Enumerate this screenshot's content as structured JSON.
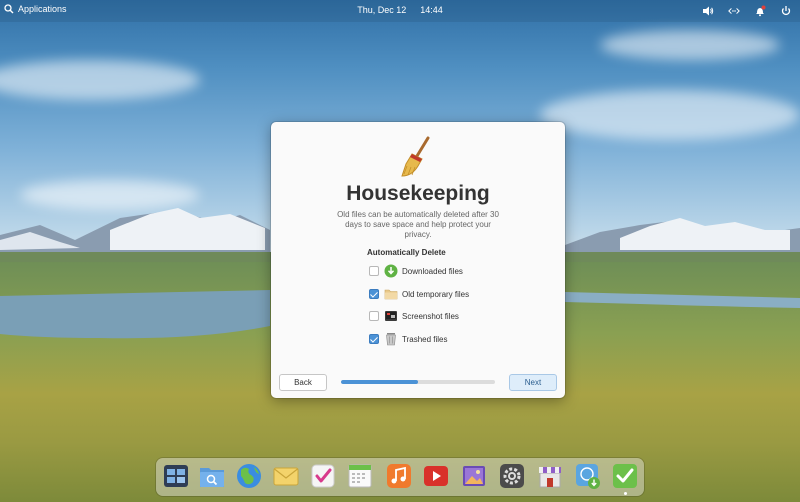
{
  "top_panel": {
    "applications_label": "Applications",
    "date": "Thu, Dec 12",
    "time": "14:44"
  },
  "dialog": {
    "title": "Housekeeping",
    "subtitle": "Old files can be automatically deleted after 30 days to save space and help protect your privacy.",
    "section_label": "Automatically Delete",
    "options": [
      {
        "label": "Downloaded files",
        "checked": false,
        "icon": "download-icon"
      },
      {
        "label": "Old temporary files",
        "checked": true,
        "icon": "folder-icon"
      },
      {
        "label": "Screenshot files",
        "checked": false,
        "icon": "screenshot-icon"
      },
      {
        "label": "Trashed files",
        "checked": true,
        "icon": "trash-icon"
      }
    ],
    "back_label": "Back",
    "next_label": "Next",
    "progress_fraction": 0.5
  },
  "dock": {
    "items": [
      "multitasking-view",
      "files",
      "web-browser",
      "mail",
      "tasks",
      "calendar",
      "music",
      "videos",
      "photos",
      "system-settings",
      "appcenter",
      "installer",
      "housekeeping-tasks"
    ]
  },
  "colors": {
    "accent": "#4b92d6",
    "dialog_bg": "#fafafa",
    "next_button_bg": "#deedfa"
  }
}
